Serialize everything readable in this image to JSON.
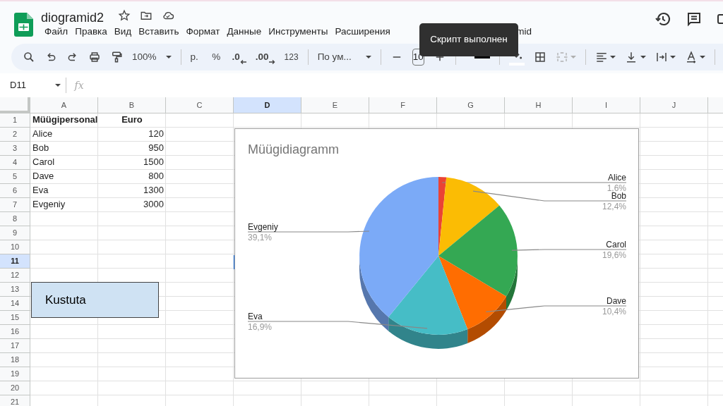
{
  "document": {
    "title": "diogramid2"
  },
  "menu": [
    {
      "label": "Файл"
    },
    {
      "label": "Правка"
    },
    {
      "label": "Вид"
    },
    {
      "label": "Вставить"
    },
    {
      "label": "Формат"
    },
    {
      "label": "Данные"
    },
    {
      "label": "Инструменты"
    },
    {
      "label": "Расширения"
    },
    {
      "label": "mid"
    }
  ],
  "tooltip": "Скрипт выполнен",
  "toolbar": {
    "zoom": "100%",
    "currency": "р.",
    "percent": "%",
    "decrease_decimals": ".0",
    "increase_decimals": ".00",
    "number_format": "123",
    "font": "По ум...",
    "font_size": "10",
    "merge_cells": {
      "disabled": true
    }
  },
  "formula_bar": {
    "name_box": "D11",
    "fx": "fx"
  },
  "columns": [
    {
      "label": "A",
      "selected": false
    },
    {
      "label": "B",
      "selected": false
    },
    {
      "label": "C",
      "selected": false
    },
    {
      "label": "D",
      "selected": true
    },
    {
      "label": "E",
      "selected": false
    },
    {
      "label": "F",
      "selected": false
    },
    {
      "label": "G",
      "selected": false
    },
    {
      "label": "H",
      "selected": false
    },
    {
      "label": "I",
      "selected": false
    },
    {
      "label": "J",
      "selected": false
    }
  ],
  "rows": [
    {
      "label": "1",
      "selected": false,
      "kind": "header",
      "cells": [
        "Müügipersonal",
        "Euro"
      ]
    },
    {
      "label": "2",
      "selected": false,
      "kind": "data",
      "cells": [
        "Alice",
        "120"
      ]
    },
    {
      "label": "3",
      "selected": false,
      "kind": "data",
      "cells": [
        "Bob",
        "950"
      ]
    },
    {
      "label": "4",
      "selected": false,
      "kind": "data",
      "cells": [
        "Carol",
        "1500"
      ]
    },
    {
      "label": "5",
      "selected": false,
      "kind": "data",
      "cells": [
        "Dave",
        "800"
      ]
    },
    {
      "label": "6",
      "selected": false,
      "kind": "data",
      "cells": [
        "Eva",
        "1300"
      ]
    },
    {
      "label": "7",
      "selected": false,
      "kind": "data",
      "cells": [
        "Evgeniy",
        "3000"
      ]
    },
    {
      "label": "8",
      "selected": false
    },
    {
      "label": "9",
      "selected": false
    },
    {
      "label": "10",
      "selected": false
    },
    {
      "label": "11",
      "selected": true
    },
    {
      "label": "12",
      "selected": false
    },
    {
      "label": "13",
      "selected": false
    },
    {
      "label": "14",
      "selected": false
    },
    {
      "label": "15",
      "selected": false
    },
    {
      "label": "16",
      "selected": false
    },
    {
      "label": "17",
      "selected": false
    },
    {
      "label": "18",
      "selected": false
    },
    {
      "label": "19",
      "selected": false
    },
    {
      "label": "20",
      "selected": false
    },
    {
      "label": "21",
      "selected": false
    }
  ],
  "shape_button": "Kustuta",
  "chart": {
    "chart_data": {
      "type": "pie",
      "title": "Müügidiagramm",
      "categories": [
        "Alice",
        "Bob",
        "Carol",
        "Dave",
        "Eva",
        "Evgeniy"
      ],
      "values": [
        1.6,
        12.4,
        19.6,
        10.4,
        16.9,
        39.1
      ],
      "value_labels": [
        "1,6%",
        "12,4%",
        "19,6%",
        "10,4%",
        "16,9%",
        "39,1%"
      ]
    }
  }
}
